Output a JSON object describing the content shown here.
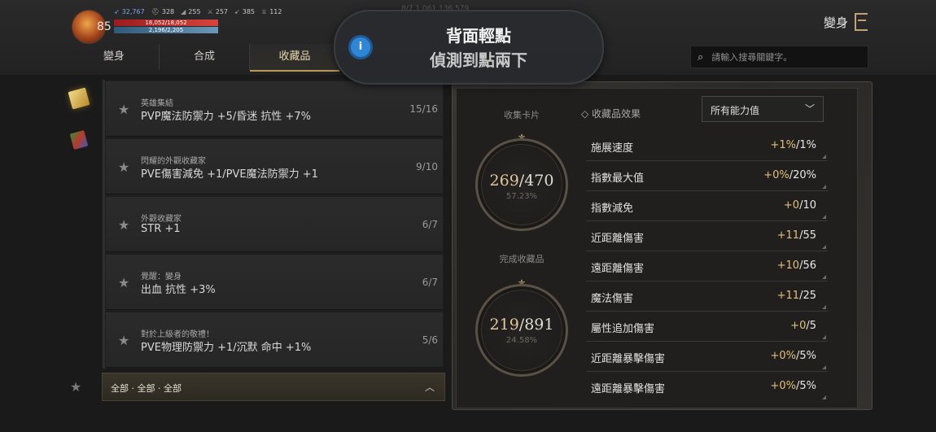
{
  "player": {
    "level": "85",
    "stats": [
      {
        "icon": "feather-icon",
        "value": "32,767",
        "blue": true
      },
      {
        "icon": "helmet-icon",
        "value": "328"
      },
      {
        "icon": "wing-icon",
        "value": "255"
      },
      {
        "icon": "sword-icon",
        "value": "257"
      },
      {
        "icon": "bow-icon",
        "value": "385"
      },
      {
        "icon": "trophy-icon",
        "value": "112"
      }
    ],
    "hp": "18,052/18,052",
    "mp": "2,196/2,205"
  },
  "faded_resources": "8/7   1,061,136,579",
  "tabs": [
    {
      "label": "變身",
      "active": false
    },
    {
      "label": "合成",
      "active": false
    },
    {
      "label": "收藏品",
      "active": true
    }
  ],
  "search": {
    "placeholder": "請輸入搜尋關鍵字。"
  },
  "transform_button": "變身",
  "toast": {
    "title": "背面輕點",
    "subtitle": "偵測到點兩下"
  },
  "collections": [
    {
      "category": "英雄集結",
      "effect": "PVP魔法防禦力 +5/昏迷 抗性 +7%",
      "count": "15/16"
    },
    {
      "category": "閃耀的外觀收藏家",
      "effect": "PVE傷害減免 +1/PVE魔法防禦力 +1",
      "count": "9/10"
    },
    {
      "category": "外觀收藏家",
      "effect": "STR +1",
      "count": "6/7"
    },
    {
      "category": "覺醒：變身",
      "effect": "出血 抗性 +3%",
      "count": "6/7"
    },
    {
      "category": "對於上級者的敬禮！",
      "effect": "PVE物理防禦力 +1/沉默 命中 +1%",
      "count": "5/6"
    }
  ],
  "filter": {
    "label": "全部 · 全部 · 全部"
  },
  "gauges": {
    "cards": {
      "label": "收集卡片",
      "current": "269",
      "total": "/470",
      "percent": "57.23%"
    },
    "completed": {
      "label": "完成收藏品",
      "current": "219",
      "total": "/891",
      "percent": "24.58%"
    }
  },
  "effects_panel": {
    "title": "收藏品效果",
    "dropdown": "所有能力值",
    "rows": [
      {
        "name": "施展速度",
        "gain": "+1%",
        "max": "/1%"
      },
      {
        "name": "指數最大值",
        "gain": "+0%",
        "max": "/20%"
      },
      {
        "name": "指數減免",
        "gain": "+0",
        "max": "/10"
      },
      {
        "name": "近距離傷害",
        "gain": "+11",
        "max": "/55"
      },
      {
        "name": "遠距離傷害",
        "gain": "+10",
        "max": "/56"
      },
      {
        "name": "魔法傷害",
        "gain": "+11",
        "max": "/25"
      },
      {
        "name": "屬性追加傷害",
        "gain": "+0",
        "max": "/5"
      },
      {
        "name": "近距離暴擊傷害",
        "gain": "+0%",
        "max": "/5%"
      },
      {
        "name": "遠距離暴擊傷害",
        "gain": "+0%",
        "max": "/5%"
      }
    ]
  }
}
